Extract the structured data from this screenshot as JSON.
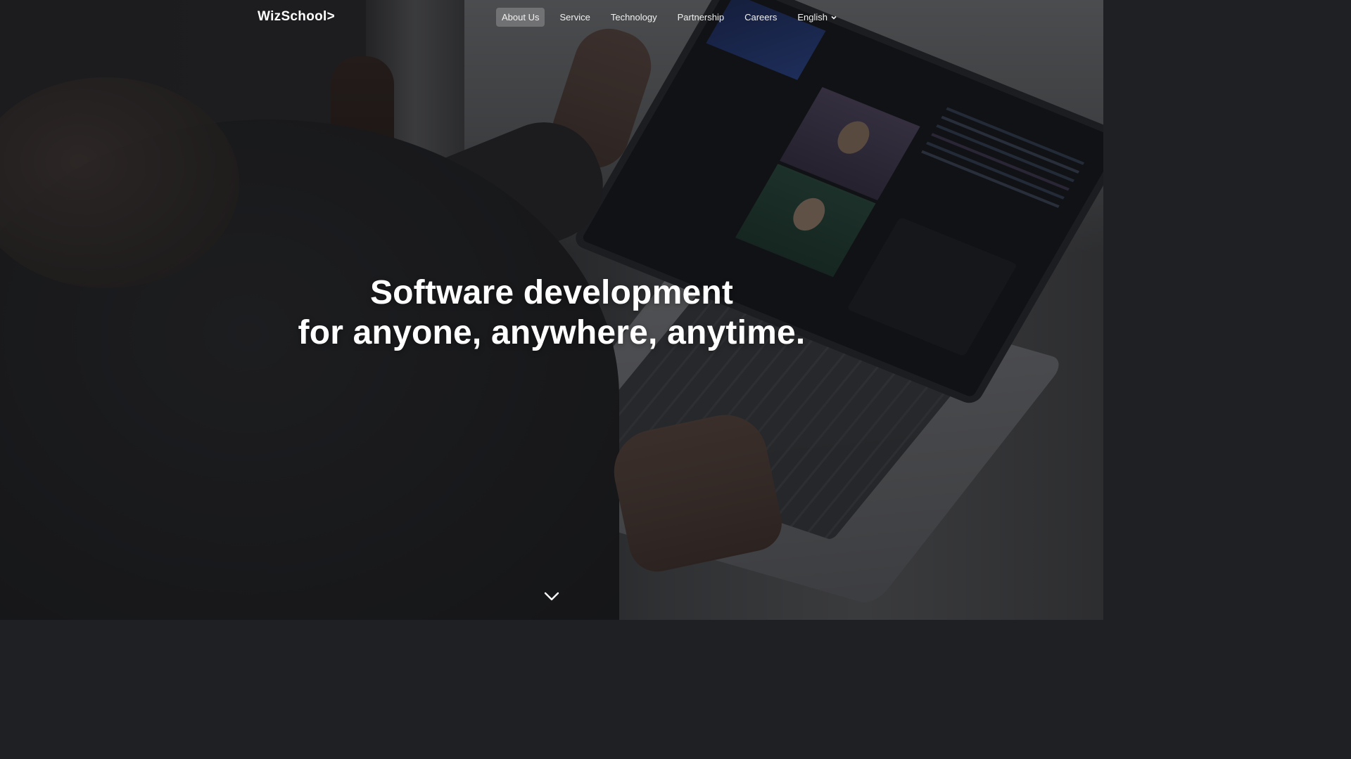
{
  "header": {
    "logo_text": "WizSchool>",
    "nav": [
      {
        "label": "About Us",
        "active": true
      },
      {
        "label": "Service"
      },
      {
        "label": "Technology"
      },
      {
        "label": "Partnership"
      },
      {
        "label": "Careers"
      }
    ],
    "language": "English"
  },
  "hero": {
    "title_line1": "Software development",
    "title_line2": "for anyone, anywhere, anytime."
  },
  "icons": {
    "language_dropdown": "chevron-down-icon",
    "scroll": "chevron-down-icon"
  },
  "colors": {
    "text": "#ffffff",
    "active_nav_bg": "rgba(255,255,255,0.22)"
  }
}
